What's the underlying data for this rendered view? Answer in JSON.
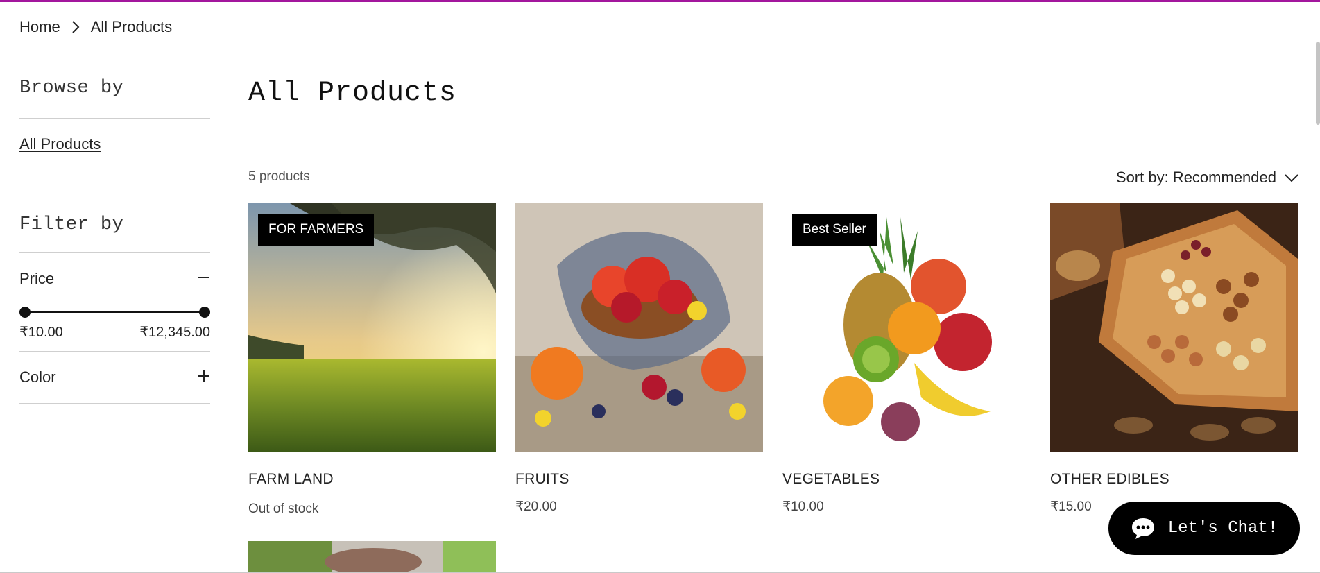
{
  "breadcrumb": {
    "home": "Home",
    "current": "All Products"
  },
  "sidebar": {
    "browse_heading": "Browse by",
    "browse_link": "All Products",
    "filter_heading": "Filter by",
    "price_label": "Price",
    "price_min": "₹10.00",
    "price_max": "₹12,345.00",
    "color_label": "Color"
  },
  "main": {
    "title": "All Products",
    "count": "5 products",
    "sort_label": "Sort by: Recommended"
  },
  "products": [
    {
      "name": "FARM LAND",
      "sub": "Out of stock",
      "badge": "FOR FARMERS"
    },
    {
      "name": "FRUITS",
      "sub": "₹20.00"
    },
    {
      "name": "VEGETABLES",
      "sub": "₹10.00",
      "badge": "Best Seller"
    },
    {
      "name": "OTHER EDIBLES",
      "sub": "₹15.00"
    }
  ],
  "chat": {
    "label": "Let's Chat!"
  },
  "colors": {
    "accent": "#a3179d",
    "badge_bg": "#000000"
  }
}
